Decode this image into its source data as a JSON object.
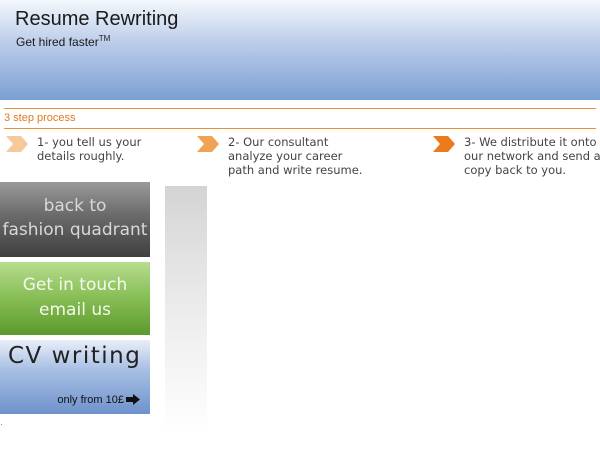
{
  "header": {
    "title": "Resume Rewriting",
    "tagline": "Get hired faster",
    "trademark": "TM"
  },
  "process": {
    "label": "3 step process",
    "steps": [
      {
        "text": "1- you tell us your details roughly.",
        "arrow_color": "#f6c99a"
      },
      {
        "text": "2- Our consultant analyze your career path and write resume.",
        "arrow_color": "#f0a355"
      },
      {
        "text": "3- We distribute it onto our network and send a copy back to you.",
        "arrow_color": "#ea7a1c"
      }
    ]
  },
  "sidebar": {
    "back": {
      "line1": "back to",
      "line2": "fashion quadrant"
    },
    "contact": {
      "line1": "Get in touch",
      "line2": "email us"
    },
    "cv": {
      "title": "CV writing",
      "price": "only from 10£",
      "icon": "arrow-right-icon"
    }
  },
  "colors": {
    "accent": "#e8913c",
    "header_bottom": "#7b9fd3",
    "back_button": "#6a6a6a",
    "contact_button": "#86bd55",
    "cv_button": "#a8bfe4"
  }
}
